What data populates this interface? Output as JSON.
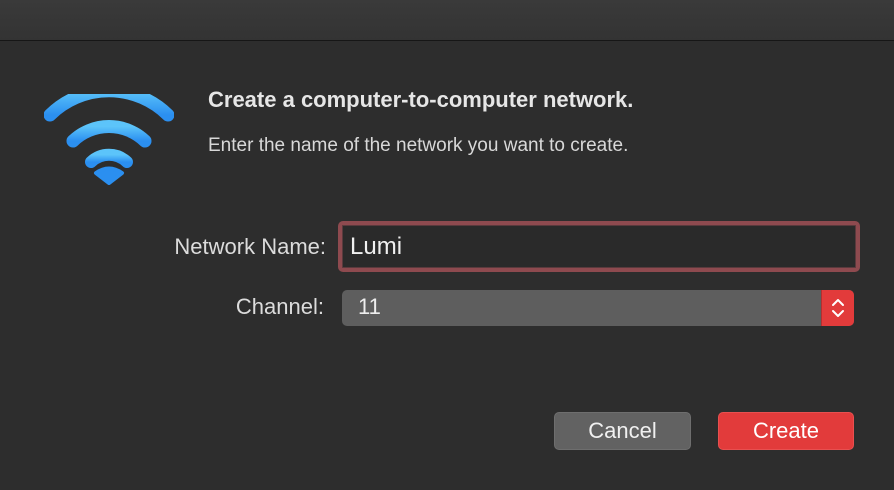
{
  "dialog": {
    "title": "Create a computer-to-computer network.",
    "subtitle": "Enter the name of the network you want to create.",
    "icon": "wifi-icon"
  },
  "form": {
    "network_name_label": "Network Name:",
    "network_name_value": "Lumi",
    "channel_label": "Channel:",
    "channel_value": "11"
  },
  "buttons": {
    "cancel_label": "Cancel",
    "create_label": "Create"
  },
  "colors": {
    "accent": "#e23b3b",
    "wifi_blue": "#3aa3f0",
    "focus_ring": "#8e4a4f"
  }
}
